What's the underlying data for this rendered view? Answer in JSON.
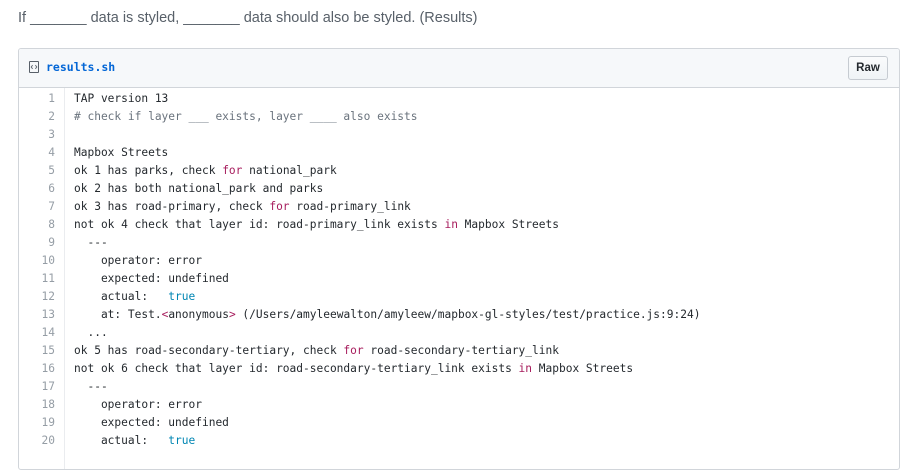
{
  "page": {
    "heading": "If _______ data is styled, _______ data should also be styled. (Results)"
  },
  "gist": {
    "file_name": "results.sh",
    "file_icon": "file-code-icon",
    "raw_label": "Raw"
  },
  "code_lines": [
    {
      "n": "1",
      "segs": [
        {
          "t": "TAP version 13",
          "c": "lc"
        }
      ]
    },
    {
      "n": "2",
      "segs": [
        {
          "t": "# check if layer ___ exists, layer ____ also exists",
          "c": "cm"
        }
      ]
    },
    {
      "n": "3",
      "segs": [
        {
          "t": "",
          "c": "lc"
        }
      ]
    },
    {
      "n": "4",
      "segs": [
        {
          "t": "Mapbox Streets",
          "c": "lc"
        }
      ]
    },
    {
      "n": "5",
      "segs": [
        {
          "t": "ok 1 has parks, check ",
          "c": "lc"
        },
        {
          "t": "for",
          "c": "kw"
        },
        {
          "t": " national_park",
          "c": "lc"
        }
      ]
    },
    {
      "n": "6",
      "segs": [
        {
          "t": "ok 2 has both national_park and parks",
          "c": "lc"
        }
      ]
    },
    {
      "n": "7",
      "segs": [
        {
          "t": "ok 3 has road-primary, check ",
          "c": "lc"
        },
        {
          "t": "for",
          "c": "kw"
        },
        {
          "t": " road-primary_link",
          "c": "lc"
        }
      ]
    },
    {
      "n": "8",
      "segs": [
        {
          "t": "not ok 4 check that layer id: road-primary_link exists ",
          "c": "lc"
        },
        {
          "t": "in",
          "c": "kw"
        },
        {
          "t": " Mapbox Streets",
          "c": "lc"
        }
      ]
    },
    {
      "n": "9",
      "segs": [
        {
          "t": "  ---",
          "c": "lc"
        }
      ]
    },
    {
      "n": "10",
      "segs": [
        {
          "t": "    operator: error",
          "c": "lc"
        }
      ]
    },
    {
      "n": "11",
      "segs": [
        {
          "t": "    expected: undefined",
          "c": "lc"
        }
      ]
    },
    {
      "n": "12",
      "segs": [
        {
          "t": "    actual:   ",
          "c": "lc"
        },
        {
          "t": "true",
          "c": "bl"
        }
      ]
    },
    {
      "n": "13",
      "segs": [
        {
          "t": "    at: Test.",
          "c": "lc"
        },
        {
          "t": "<",
          "c": "kw"
        },
        {
          "t": "anonymous",
          "c": "lc"
        },
        {
          "t": ">",
          "c": "kw"
        },
        {
          "t": " (/Users/amyleewalton/amyleew/mapbox-gl-styles/test/practice.js:9:24)",
          "c": "lc"
        }
      ]
    },
    {
      "n": "14",
      "segs": [
        {
          "t": "  ...",
          "c": "lc"
        }
      ]
    },
    {
      "n": "15",
      "segs": [
        {
          "t": "ok 5 has road-secondary-tertiary, check ",
          "c": "lc"
        },
        {
          "t": "for",
          "c": "kw"
        },
        {
          "t": " road-secondary-tertiary_link",
          "c": "lc"
        }
      ]
    },
    {
      "n": "16",
      "segs": [
        {
          "t": "not ok 6 check that layer id: road-secondary-tertiary_link exists ",
          "c": "lc"
        },
        {
          "t": "in",
          "c": "kw"
        },
        {
          "t": " Mapbox Streets",
          "c": "lc"
        }
      ]
    },
    {
      "n": "17",
      "segs": [
        {
          "t": "  ---",
          "c": "lc"
        }
      ]
    },
    {
      "n": "18",
      "segs": [
        {
          "t": "    operator: error",
          "c": "lc"
        }
      ]
    },
    {
      "n": "19",
      "segs": [
        {
          "t": "    expected: undefined",
          "c": "lc"
        }
      ]
    },
    {
      "n": "20",
      "segs": [
        {
          "t": "    actual:   ",
          "c": "lc"
        },
        {
          "t": "true",
          "c": "bl"
        }
      ]
    }
  ]
}
